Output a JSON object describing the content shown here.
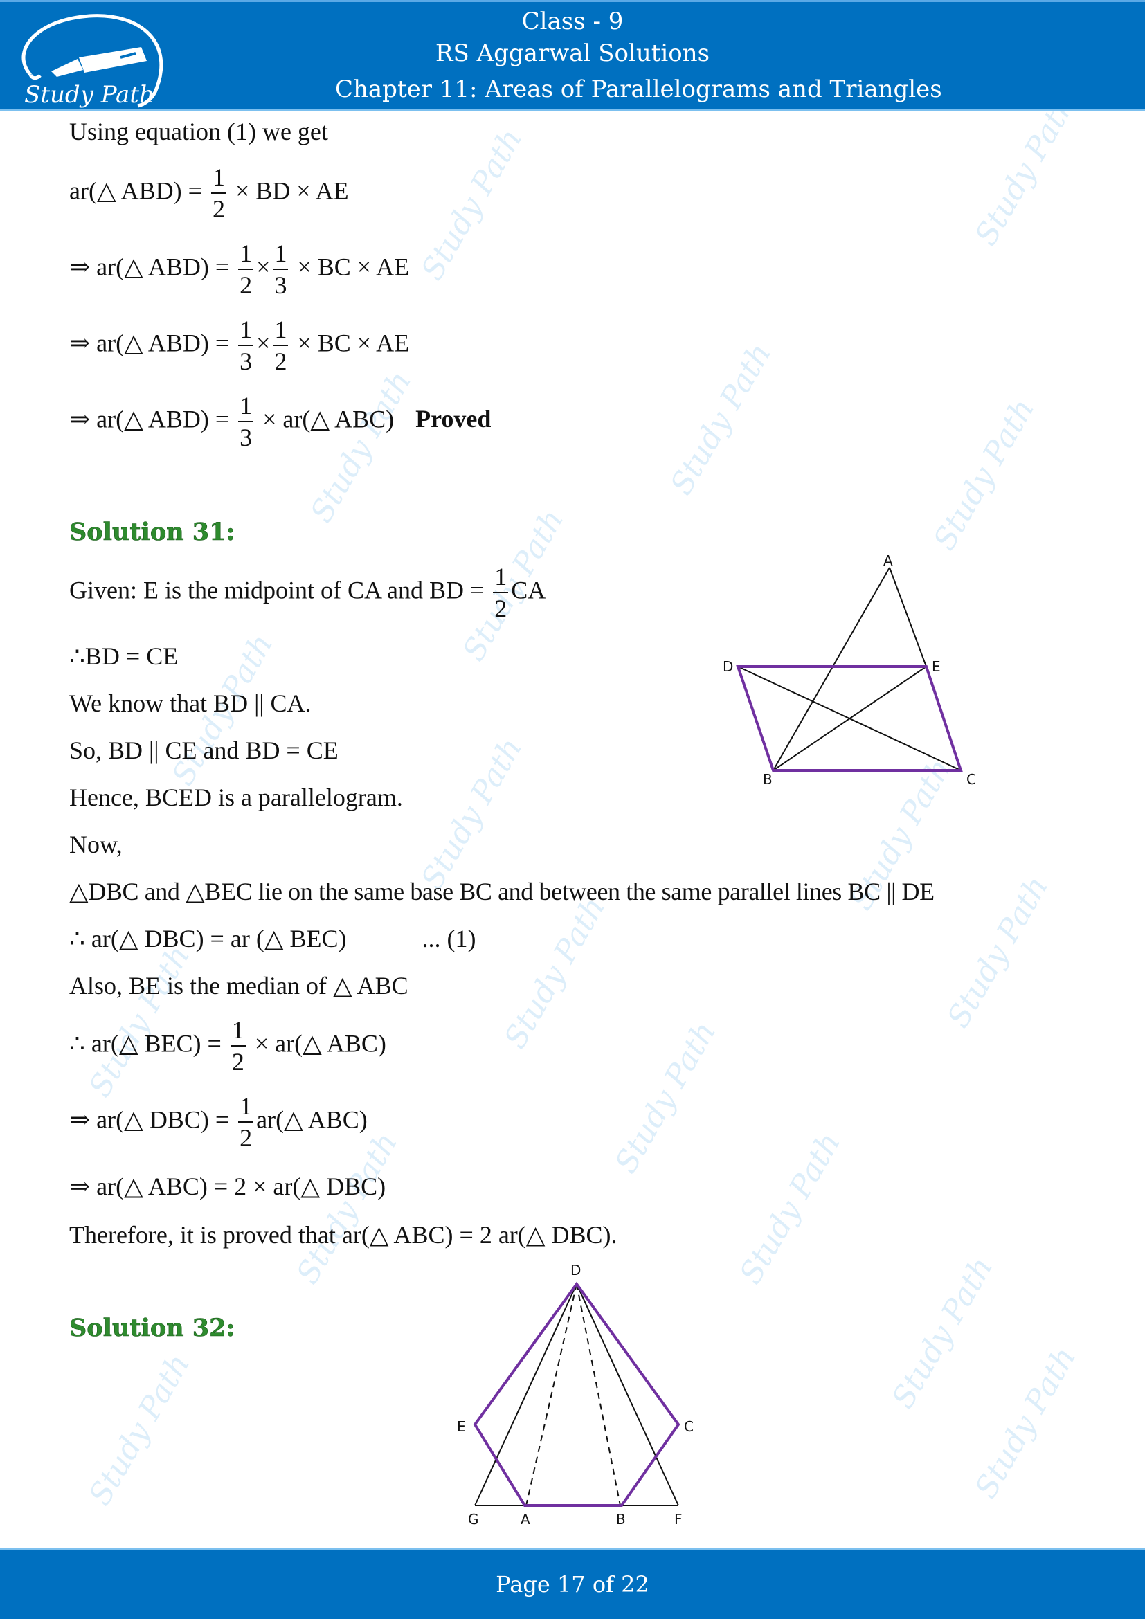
{
  "header": {
    "logo_text": "Study Path",
    "class_label": "Class - 9",
    "book_title": "RS Aggarwal Solutions",
    "chapter_title": "Chapter 11: Areas of Parallelograms and Triangles"
  },
  "colors": {
    "brand_blue": "#0070c0",
    "heading_green": "#2e8b2e",
    "figure_purple": "#7030a0",
    "watermark": "#cfe8f8"
  },
  "watermark_text": "Study Path",
  "prev_solution": {
    "intro": "Using equation (1) we get",
    "steps": [
      {
        "prefix": "",
        "lhs": "ar(△ ABD) =",
        "fracs": [
          [
            "1",
            "2"
          ]
        ],
        "rhs": "× BD × AE"
      },
      {
        "prefix": "⇒",
        "lhs": "ar(△ ABD) =",
        "fracs": [
          [
            "1",
            "2"
          ],
          [
            "1",
            "3"
          ]
        ],
        "rhs": "× BC × AE"
      },
      {
        "prefix": "⇒",
        "lhs": "ar(△ ABD) =",
        "fracs": [
          [
            "1",
            "3"
          ],
          [
            "1",
            "2"
          ]
        ],
        "rhs": "× BC × AE"
      },
      {
        "prefix": "⇒",
        "lhs": "ar(△ ABD) =",
        "fracs": [
          [
            "1",
            "3"
          ]
        ],
        "rhs": "× ar(△ ABC)",
        "tag": "Proved"
      }
    ]
  },
  "solution31": {
    "heading": "Solution 31:",
    "given_prefix": "Given: E is the midpoint of CA and BD =",
    "given_frac": [
      "1",
      "2"
    ],
    "given_suffix": "CA",
    "lines": [
      "∴BD = CE",
      "We know that BD || CA.",
      "So, BD || CE and BD = CE",
      "Hence, BCED is a parallelogram.",
      "Now,",
      "△DBC and △BEC lie on the same base BC and between the same parallel lines BC || DE",
      "∴ ar(△ DBC) = ar (△ BEC)",
      "Also, BE is the median of △ ABC"
    ],
    "eq_ref": "... (1)",
    "step1": {
      "prefix": "∴",
      "lhs": "ar(△ BEC) =",
      "frac": [
        "1",
        "2"
      ],
      "rhs": "× ar(△ ABC)"
    },
    "step2": {
      "prefix": "⇒",
      "lhs": "ar(△ DBC) =",
      "frac": [
        "1",
        "2"
      ],
      "rhs": "ar(△ ABC)"
    },
    "step3": "⇒ ar(△ ABC) = 2 × ar(△ DBC)",
    "conclusion": "Therefore, it is proved that ar(△ ABC) = 2 ar(△ DBC).",
    "figure_labels": {
      "A": "A",
      "B": "B",
      "C": "C",
      "D": "D",
      "E": "E"
    }
  },
  "solution32": {
    "heading": "Solution 32:",
    "figure_labels": {
      "D": "D",
      "E": "E",
      "C": "C",
      "G": "G",
      "A": "A",
      "B": "B",
      "F": "F"
    }
  },
  "footer": {
    "page_prefix": "Page",
    "page_current": "17",
    "page_of": "of",
    "page_total": "22"
  }
}
